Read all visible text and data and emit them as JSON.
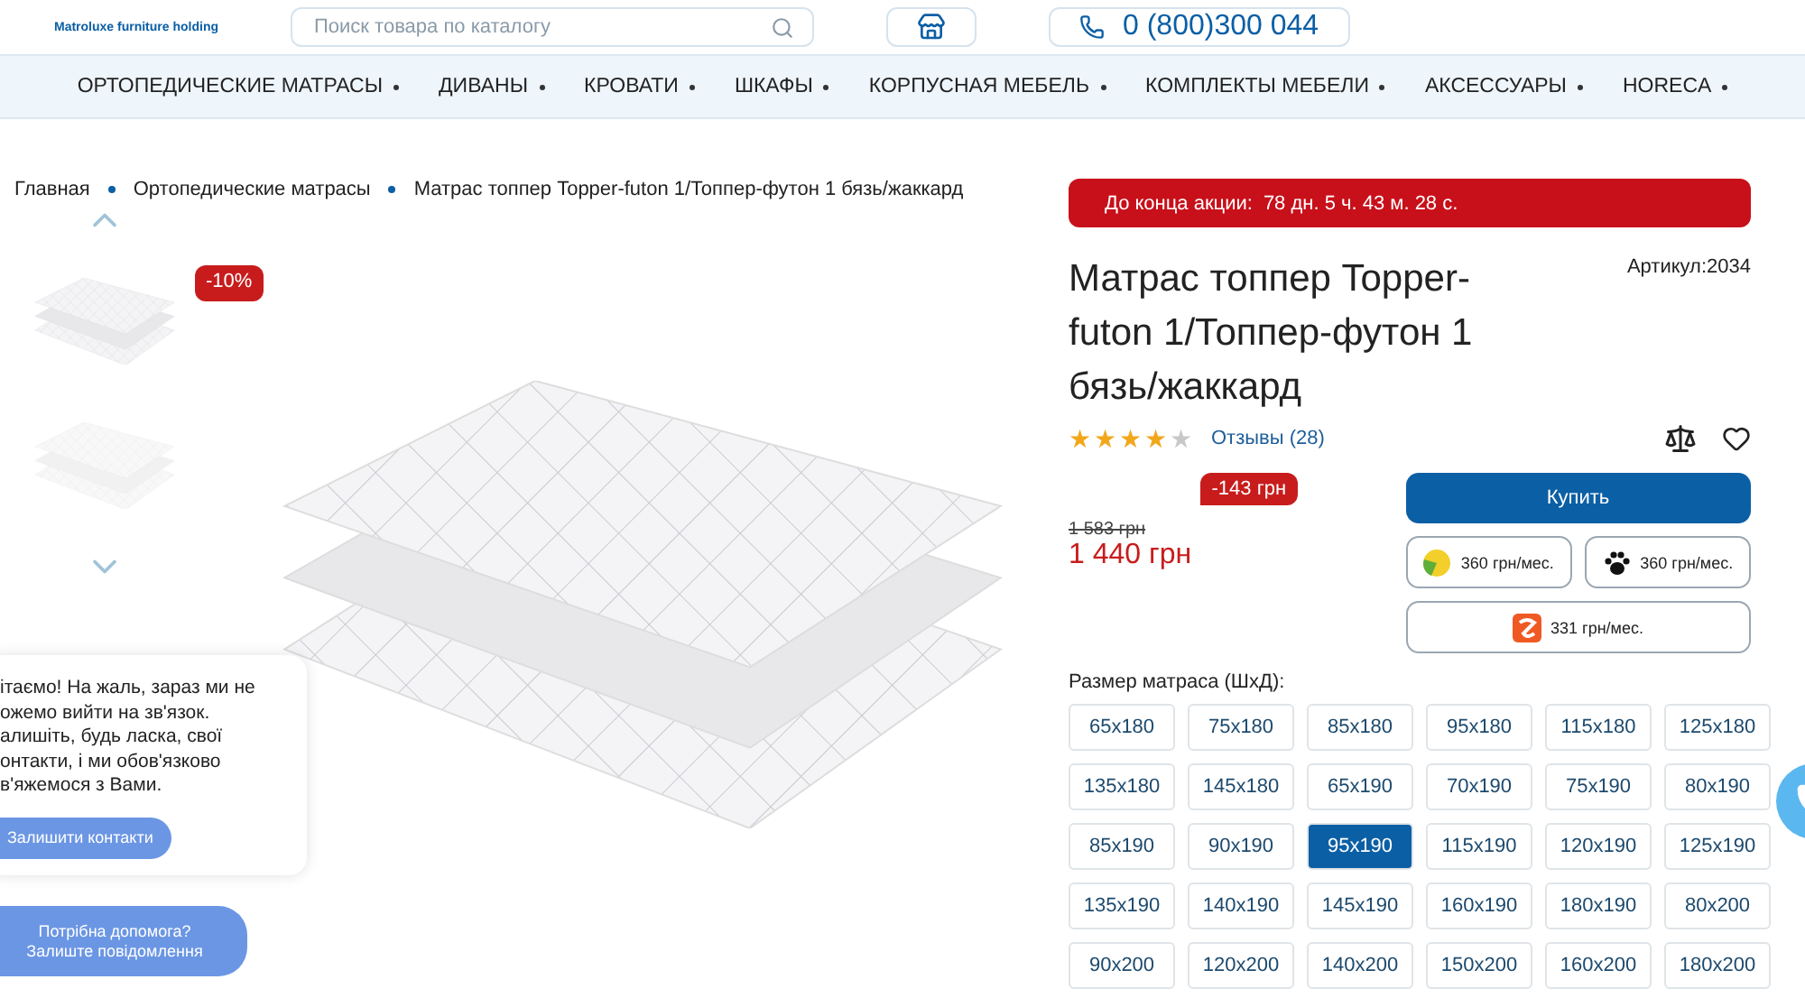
{
  "header": {
    "logo_subtitle": "Matroluxe furniture holding",
    "search": {
      "placeholder": "Поиск товара по каталогу"
    },
    "phone": "0 (800)300 044"
  },
  "nav": [
    "ОРТОПЕДИЧЕСКИЕ МАТРАСЫ",
    "ДИВАНЫ",
    "КРОВАТИ",
    "ШКАФЫ",
    "КОРПУСНАЯ МЕБЕЛЬ",
    "КОМПЛЕКТЫ МЕБЕЛИ",
    "АКСЕССУАРЫ",
    "HORECA"
  ],
  "breadcrumbs": [
    "Главная",
    "Ортопедические матрасы",
    "Матрас топпер Topper-futon 1/Топпер-футон 1 бязь/жаккард"
  ],
  "gallery": {
    "badge": "-10%"
  },
  "promo": {
    "label": "До конца акции:",
    "countdown": "78 дн. 5 ч. 43 м. 28 с."
  },
  "product": {
    "title": "Матрас топпер Topper-futon 1/Топпер-футон 1 бязь/жаккард",
    "sku": "Артикул:2034",
    "stars": 4,
    "reviews": "Отзывы (28)",
    "discount": "-143 грн",
    "old_price": "1 583 грн",
    "price": "1 440 грн",
    "buy": "Купить",
    "installments": [
      {
        "kind": "lemon",
        "text": "360 грн/мес."
      },
      {
        "kind": "paw",
        "text": "360 грн/мес."
      },
      {
        "kind": "shield",
        "text": "331 грн/мес."
      }
    ]
  },
  "sizes": {
    "label": "Размер матраса (ШхД):",
    "options": [
      {
        "text": "65x180",
        "selected": false
      },
      {
        "text": "75x180",
        "selected": false
      },
      {
        "text": "85x180",
        "selected": false
      },
      {
        "text": "95x180",
        "selected": false
      },
      {
        "text": "115x180",
        "selected": false
      },
      {
        "text": "125x180",
        "selected": false
      },
      {
        "text": "135x180",
        "selected": false
      },
      {
        "text": "145x180",
        "selected": false
      },
      {
        "text": "65x190",
        "selected": false
      },
      {
        "text": "70x190",
        "selected": false
      },
      {
        "text": "75x190",
        "selected": false
      },
      {
        "text": "80x190",
        "selected": false
      },
      {
        "text": "85x190",
        "selected": false
      },
      {
        "text": "90x190",
        "selected": false
      },
      {
        "text": "95x190",
        "selected": true
      },
      {
        "text": "115x190",
        "selected": false
      },
      {
        "text": "120x190",
        "selected": false
      },
      {
        "text": "125x190",
        "selected": false
      },
      {
        "text": "135x190",
        "selected": false
      },
      {
        "text": "140x190",
        "selected": false
      },
      {
        "text": "145x190",
        "selected": false
      },
      {
        "text": "160x190",
        "selected": false
      },
      {
        "text": "180x190",
        "selected": false
      },
      {
        "text": "80x200",
        "selected": false
      },
      {
        "text": "90x200",
        "selected": false
      },
      {
        "text": "120x200",
        "selected": false
      },
      {
        "text": "140x200",
        "selected": false
      },
      {
        "text": "150x200",
        "selected": false
      },
      {
        "text": "160x200",
        "selected": false
      },
      {
        "text": "180x200",
        "selected": false
      }
    ]
  },
  "chat": {
    "message": "ітаємо! На жаль, зараз ми не\nожемо вийти на зв'язок.\nалишіть, будь ласка, свої\nонтакти, і ми обов'язково\nв'яжемося з Вами.",
    "button": "Залишити контакти",
    "help": "Потрібна допомога?\nЗалиште повідомлення"
  }
}
